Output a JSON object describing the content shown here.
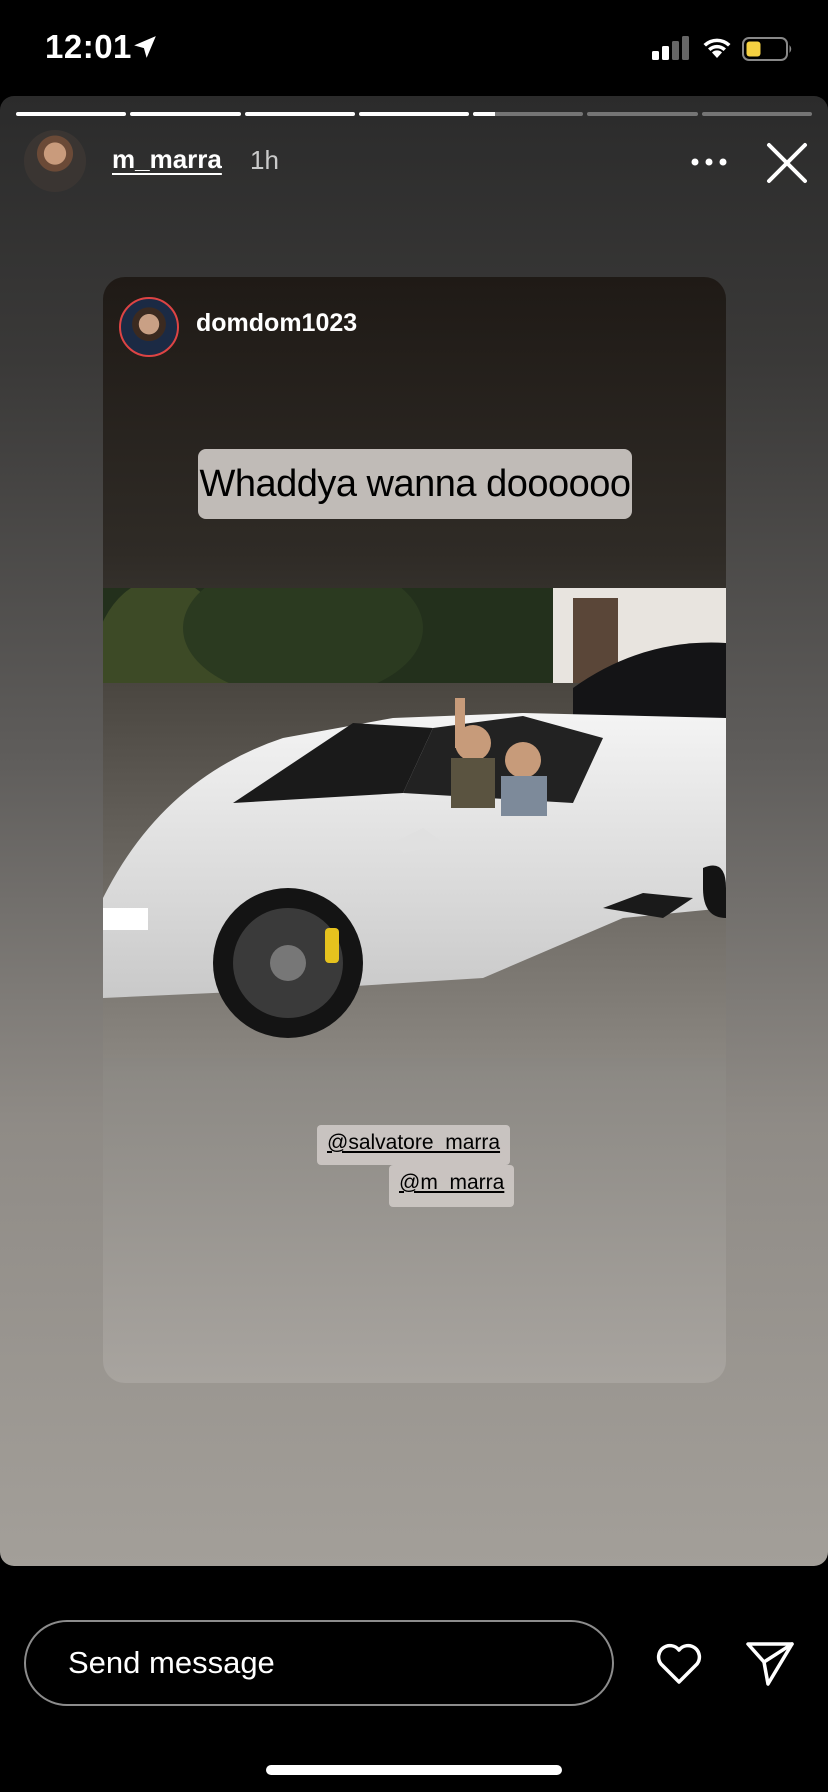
{
  "status_bar": {
    "time": "12:01",
    "icons": [
      "location-arrow-icon",
      "cellular-signal-icon",
      "wifi-icon",
      "battery-icon"
    ],
    "battery_color": "#f5d142"
  },
  "story": {
    "progress": {
      "segments": 7,
      "completed": 4,
      "current_progress": 0.2
    },
    "header": {
      "username": "m_marra",
      "time_ago": "1h",
      "icons": [
        "avatar",
        "more-icon",
        "close-icon"
      ]
    },
    "shared_post": {
      "username": "domdom1023",
      "caption": "Whaddya wanna doooooo",
      "mentions": [
        "@salvatore_marra",
        "@m_marra"
      ],
      "photo_icon": "car-photo"
    }
  },
  "bottom_bar": {
    "message_placeholder": "Send message",
    "icons": [
      "heart-icon",
      "send-icon"
    ]
  }
}
